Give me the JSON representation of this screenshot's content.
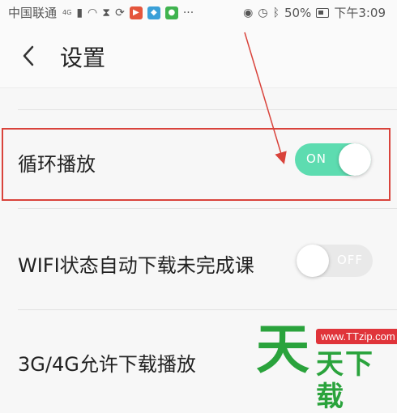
{
  "status_bar": {
    "carrier": "中国联通",
    "network_tag": "4G",
    "battery": "50%",
    "time": "下午3:09",
    "icons": [
      "signal-icon",
      "wifi-icon",
      "hourglass-icon",
      "sync-icon",
      "ting-app-icon",
      "chat-app-icon",
      "tv-app-icon",
      "more-dots-icon",
      "eye-icon",
      "alarm-icon",
      "bluetooth-icon",
      "battery-icon"
    ]
  },
  "header": {
    "back_glyph": "‹",
    "title": "设置"
  },
  "settings": [
    {
      "label": "循环播放",
      "toggle_text": "ON",
      "state": "on"
    },
    {
      "label": "WIFI状态自动下载未完成课",
      "toggle_text": "OFF",
      "state": "off"
    },
    {
      "label": "3G/4G允许下载播放"
    }
  ],
  "colors": {
    "toggle_on": "#5ddcb0",
    "toggle_off": "#e9e9e9",
    "highlight": "#d9433b",
    "watermark": "#2aa33c"
  },
  "watermark": {
    "big_char": "天",
    "site": "www.TTzip.com",
    "text": "天下载"
  }
}
